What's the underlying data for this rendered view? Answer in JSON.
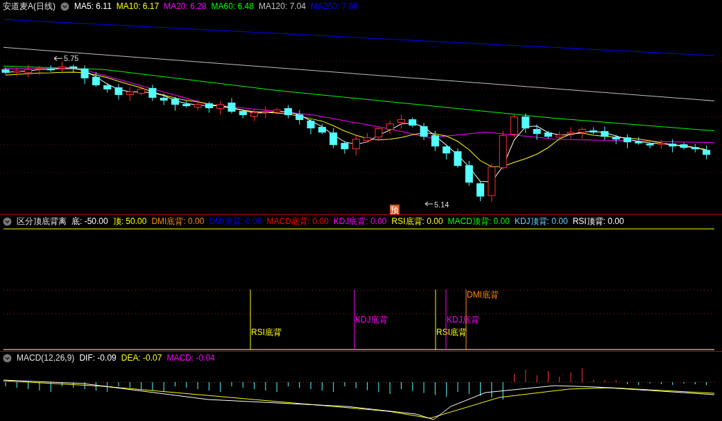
{
  "main_panel": {
    "title": "安道麦A(日线)",
    "indicators": [
      {
        "label": "MA5: 6.11",
        "color": "#ffffff"
      },
      {
        "label": "MA10: 6.17",
        "color": "#ffff00"
      },
      {
        "label": "MA20: 6.28",
        "color": "#ff00ff"
      },
      {
        "label": "MA60: 6.48",
        "color": "#00ff00"
      },
      {
        "label": "MA120: 7.04",
        "color": "#c0c0c0"
      },
      {
        "label": "MA250: 7.86",
        "color": "#0000ff"
      }
    ],
    "high_label": "5.75",
    "low_label": "5.14",
    "forecast_badge": "预"
  },
  "divergence_panel": {
    "title": "区分顶底背离",
    "values": [
      {
        "label": "底: -50.00",
        "color": "#ffffff"
      },
      {
        "label": "顶: 50.00",
        "color": "#ffff00"
      },
      {
        "label": "DMI底背: 0.00",
        "color": "#ff8c00"
      },
      {
        "label": "DMI顶背: 0.00",
        "color": "#0000ff"
      },
      {
        "label": "MACD底背: 0.00",
        "color": "#ff0000"
      },
      {
        "label": "KDJ底背: 0.00",
        "color": "#ff00ff"
      },
      {
        "label": "RSI底背: 0.00",
        "color": "#ffff00"
      },
      {
        "label": "MACD顶背: 0.00",
        "color": "#00ff00"
      },
      {
        "label": "KDJ顶背: 0.00",
        "color": "#66ccff"
      },
      {
        "label": "RSI顶背: 0.00",
        "color": "#ffffff"
      }
    ],
    "signals": [
      {
        "label": "RSI底背",
        "color": "#ffff00"
      },
      {
        "label": "KDJ底背",
        "color": "#ff00ff"
      },
      {
        "label": "RSI底背",
        "color": "#ffff00"
      },
      {
        "label": "KDJ底背",
        "color": "#ff00ff"
      },
      {
        "label": "DMI底背",
        "color": "#ff8c00"
      }
    ]
  },
  "macd_panel": {
    "title": "MACD(12,26,9)",
    "values": [
      {
        "label": "DIF: -0.09",
        "color": "#ffffff"
      },
      {
        "label": "DEA: -0.07",
        "color": "#ffff00"
      },
      {
        "label": "MACD: -0.04",
        "color": "#ff00ff"
      }
    ]
  }
}
